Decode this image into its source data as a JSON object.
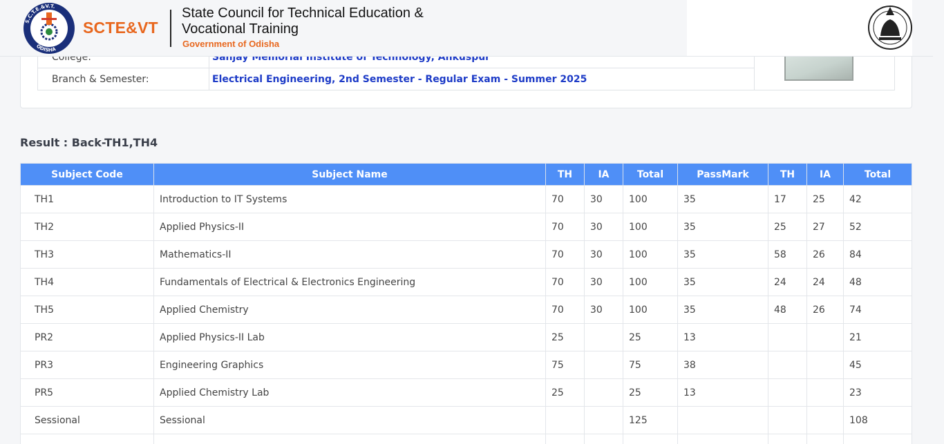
{
  "header": {
    "brand": "SCTE&VT",
    "org_line1": "State Council for Technical Education &",
    "org_line2": "Vocational Training",
    "org_gov": "Government of Odisha",
    "logo_text": "S.C.T.E.&V.T. ODISHA"
  },
  "student": {
    "rows": [
      {
        "label": "College:",
        "value": "Sanjay Memorial Institute of Technology, Ankuspur"
      },
      {
        "label": "Branch & Semester:",
        "value": "Electrical Engineering, 2nd Semester - Regular Exam - Summer 2025"
      }
    ]
  },
  "result": {
    "heading": "Result : Back-TH1,TH4"
  },
  "table": {
    "headers": [
      "Subject Code",
      "Subject Name",
      "TH",
      "IA",
      "Total",
      "PassMark",
      "TH",
      "IA",
      "Total"
    ],
    "rows": [
      [
        "TH1",
        "Introduction to IT Systems",
        "70",
        "30",
        "100",
        "35",
        "17",
        "25",
        "42"
      ],
      [
        "TH2",
        "Applied Physics-II",
        "70",
        "30",
        "100",
        "35",
        "25",
        "27",
        "52"
      ],
      [
        "TH3",
        "Mathematics-II",
        "70",
        "30",
        "100",
        "35",
        "58",
        "26",
        "84"
      ],
      [
        "TH4",
        "Fundamentals of Electrical & Electronics Engineering",
        "70",
        "30",
        "100",
        "35",
        "24",
        "24",
        "48"
      ],
      [
        "TH5",
        "Applied Chemistry",
        "70",
        "30",
        "100",
        "35",
        "48",
        "26",
        "74"
      ],
      [
        "PR2",
        "Applied Physics-II Lab",
        "25",
        "",
        "25",
        "13",
        "",
        "",
        "21"
      ],
      [
        "PR3",
        "Engineering Graphics",
        "75",
        "",
        "75",
        "38",
        "",
        "",
        "45"
      ],
      [
        "PR5",
        "Applied Chemistry Lab",
        "25",
        "",
        "25",
        "13",
        "",
        "",
        "23"
      ],
      [
        "Sessional",
        "Sessional",
        "",
        "",
        "125",
        "",
        "",
        "",
        "108"
      ],
      [
        "",
        "",
        "",
        "",
        "",
        "",
        "",
        "",
        ""
      ]
    ]
  },
  "colors": {
    "table_header": "#4f8ff7",
    "brand_orange": "#e8671e",
    "value_blue": "#1d3bc7"
  }
}
